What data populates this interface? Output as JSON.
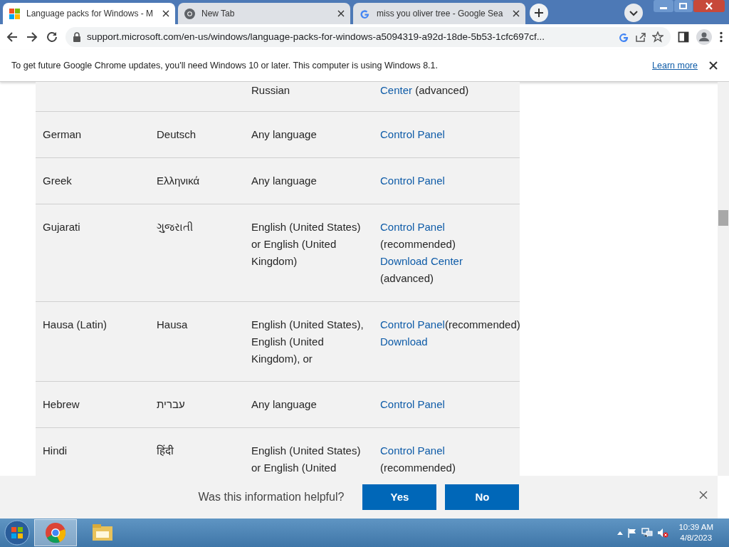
{
  "tabs": [
    {
      "kind": "windows",
      "title": "Language packs for Windows - M",
      "selected": true
    },
    {
      "kind": "chrome",
      "title": "New Tab",
      "selected": false
    },
    {
      "kind": "google",
      "title": "miss you oliver tree - Google Sea",
      "selected": false
    }
  ],
  "address": "support.microsoft.com/en-us/windows/language-packs-for-windows-a5094319-a92d-18de-5b53-1cfc697cf...",
  "infobar": {
    "message": "To get future Google Chrome updates, you'll need Windows 10 or later. This computer is using Windows 8.1.",
    "link": "Learn more"
  },
  "table": {
    "rows": [
      {
        "kind": "partial",
        "cells": [
          [],
          [],
          [
            {
              "kind": "text",
              "text": "Russian"
            }
          ],
          [
            {
              "kind": "link",
              "text": "Center"
            },
            {
              "kind": "text",
              "text": " (advanced)"
            }
          ]
        ]
      },
      {
        "kind": "full",
        "cells": [
          [
            {
              "kind": "text",
              "text": "German"
            }
          ],
          [
            {
              "kind": "text",
              "text": "Deutsch"
            }
          ],
          [
            {
              "kind": "text",
              "text": "Any language"
            }
          ],
          [
            {
              "kind": "link",
              "text": "Control Panel"
            }
          ]
        ]
      },
      {
        "kind": "full",
        "cells": [
          [
            {
              "kind": "text",
              "text": "Greek"
            }
          ],
          [
            {
              "kind": "text",
              "text": "Ελληνικά"
            }
          ],
          [
            {
              "kind": "text",
              "text": "Any language"
            }
          ],
          [
            {
              "kind": "link",
              "text": "Control Panel"
            }
          ]
        ]
      },
      {
        "kind": "full",
        "cells": [
          [
            {
              "kind": "text",
              "text": "Gujarati"
            }
          ],
          [
            {
              "kind": "text",
              "text": "ગુજરાતી"
            }
          ],
          [
            {
              "kind": "text",
              "text": "English (United States) or English (United Kingdom)"
            }
          ],
          [
            {
              "kind": "link",
              "text": "Control Panel"
            },
            {
              "kind": "text",
              "text": " (recommended) "
            },
            {
              "kind": "link",
              "text": "Download Center"
            },
            {
              "kind": "text",
              "text": " (advanced)"
            }
          ]
        ]
      },
      {
        "kind": "clipped",
        "cells": [
          [
            {
              "kind": "text",
              "text": "Hausa (Latin)"
            }
          ],
          [
            {
              "kind": "text",
              "text": "Hausa"
            }
          ],
          [
            {
              "kind": "text",
              "text": "English (United States), English (United Kingdom), or"
            }
          ],
          [
            {
              "kind": "link",
              "text": "Control Panel"
            },
            {
              "kind": "text",
              "text": "(recommended) "
            },
            {
              "kind": "link",
              "text": "Download"
            }
          ]
        ]
      },
      {
        "kind": "full",
        "cells": [
          [
            {
              "kind": "text",
              "text": "Hebrew"
            }
          ],
          [
            {
              "kind": "text",
              "text": "עברית"
            }
          ],
          [
            {
              "kind": "text",
              "text": "Any language"
            }
          ],
          [
            {
              "kind": "link",
              "text": "Control Panel"
            }
          ]
        ]
      },
      {
        "kind": "full",
        "cells": [
          [
            {
              "kind": "text",
              "text": "Hindi"
            }
          ],
          [
            {
              "kind": "text",
              "text": "हिंदी"
            }
          ],
          [
            {
              "kind": "text",
              "text": "English (United States) or English (United"
            }
          ],
          [
            {
              "kind": "link",
              "text": "Control Panel"
            },
            {
              "kind": "text",
              "text": " (recommended)"
            }
          ]
        ]
      }
    ]
  },
  "feedback": {
    "question": "Was this information helpful?",
    "buttons": [
      "Yes",
      "No"
    ]
  },
  "taskbar": {
    "apps": [
      {
        "kind": "chrome",
        "selected": true
      },
      {
        "kind": "explorer",
        "selected": false
      }
    ],
    "time": "10:39 AM",
    "date": "4/8/2023"
  }
}
